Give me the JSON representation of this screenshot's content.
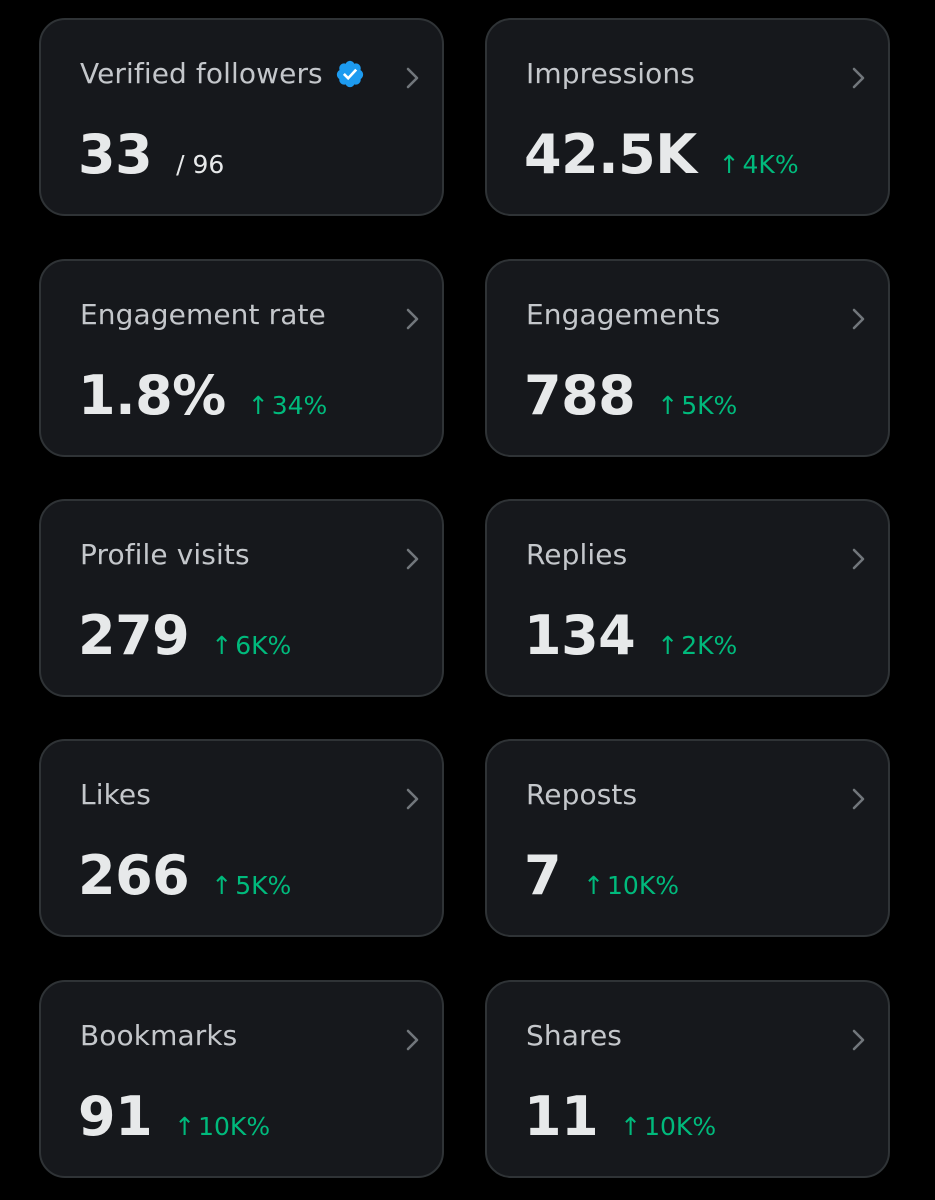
{
  "colors": {
    "background": "#000000",
    "card_background": "#16181c",
    "card_border": "#2f3336",
    "title_text": "#c4c7cb",
    "value_text": "#e7e9ea",
    "positive_change": "#00ba7c",
    "verified_badge": "#1d9bf0"
  },
  "icons": {
    "verified": "verified-badge-icon",
    "chevron": "chevron-right-icon",
    "change_arrow": "arrow-up-icon"
  },
  "cards": {
    "verified_followers": {
      "title": "Verified followers",
      "value": "33",
      "total": "/ 96"
    },
    "impressions": {
      "title": "Impressions",
      "value": "42.5K",
      "change": "4K%"
    },
    "engagement_rate": {
      "title": "Engagement rate",
      "value": "1.8%",
      "change": "34%"
    },
    "engagements": {
      "title": "Engagements",
      "value": "788",
      "change": "5K%"
    },
    "profile_visits": {
      "title": "Profile visits",
      "value": "279",
      "change": "6K%"
    },
    "replies": {
      "title": "Replies",
      "value": "134",
      "change": "2K%"
    },
    "likes": {
      "title": "Likes",
      "value": "266",
      "change": "5K%"
    },
    "reposts": {
      "title": "Reposts",
      "value": "7",
      "change": "10K%"
    },
    "bookmarks": {
      "title": "Bookmarks",
      "value": "91",
      "change": "10K%"
    },
    "shares": {
      "title": "Shares",
      "value": "11",
      "change": "10K%"
    }
  },
  "arrow_glyph": "↑"
}
